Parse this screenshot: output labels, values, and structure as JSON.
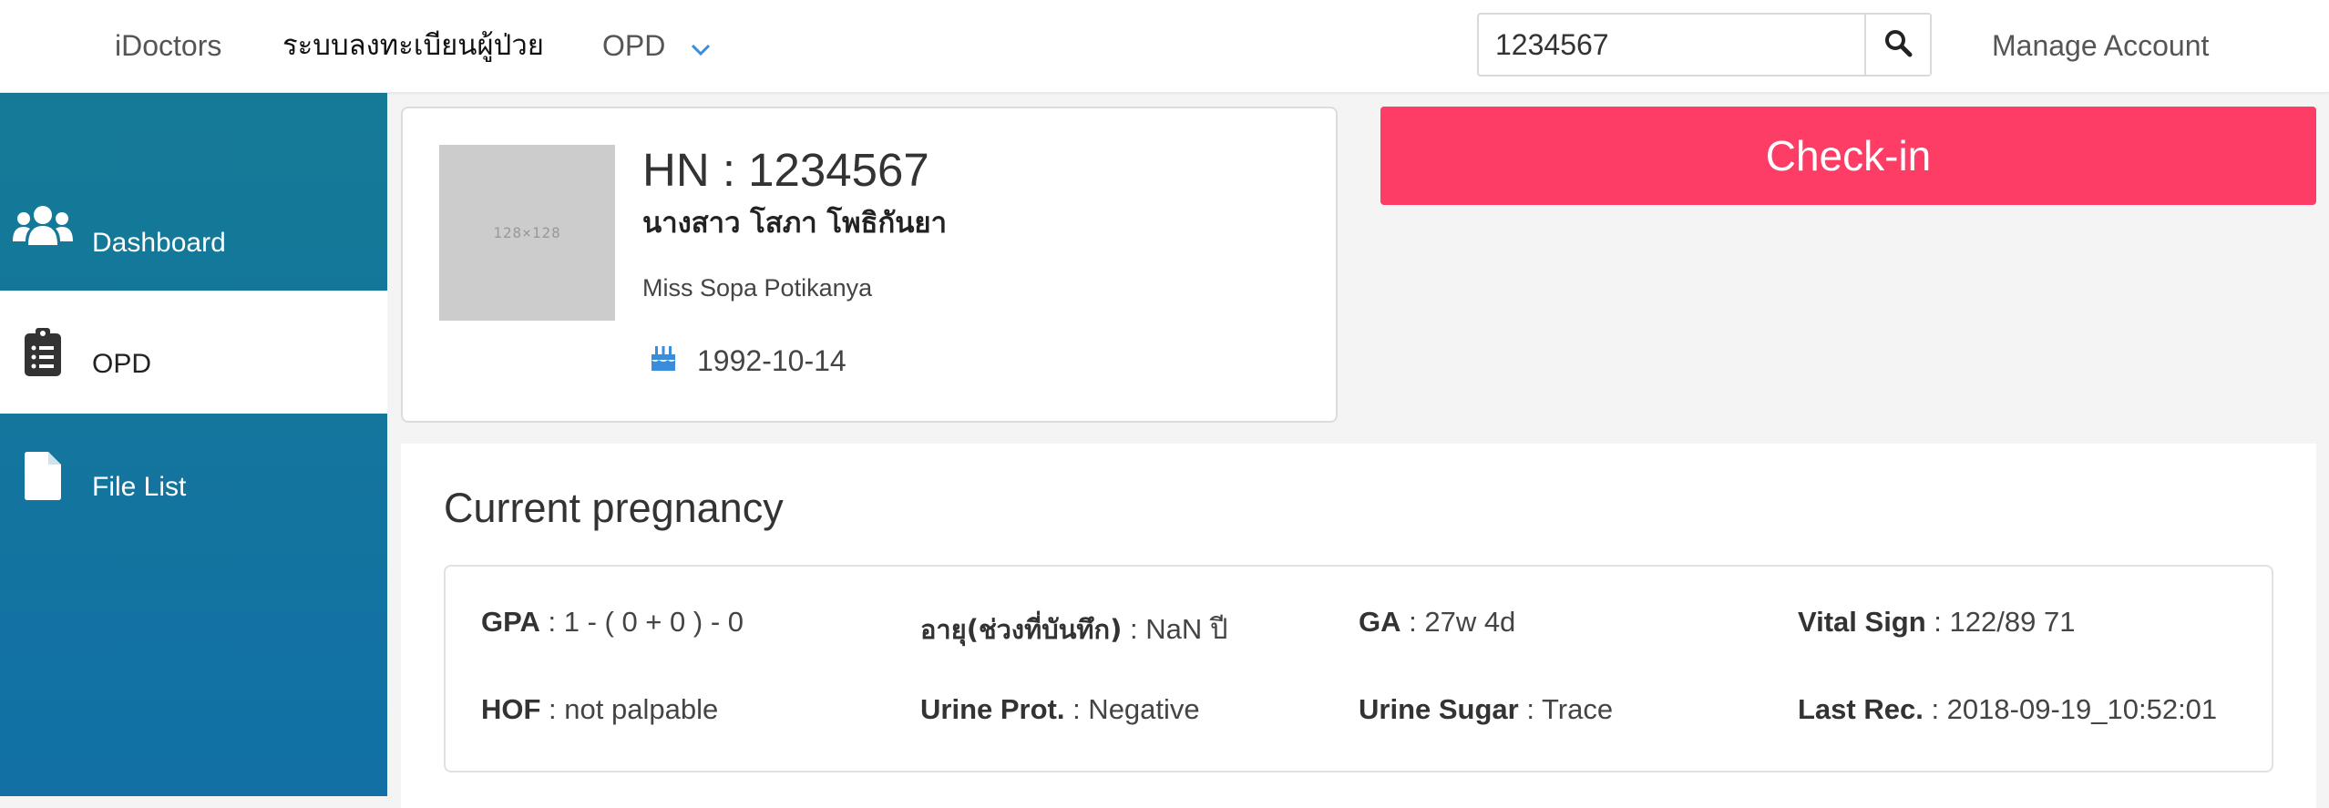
{
  "navbar": {
    "brand": "iDoctors",
    "register_label": "ระบบลงทะเบียนผู้ป่วย",
    "opd_label": "OPD",
    "search_value": "1234567",
    "manage_account": "Manage Account"
  },
  "sidebar": {
    "items": [
      {
        "label": "Dashboard",
        "icon": "users-icon"
      },
      {
        "label": "OPD",
        "icon": "clipboard-icon"
      },
      {
        "label": "File List",
        "icon": "file-icon"
      }
    ]
  },
  "patient": {
    "photo_placeholder": "128×128",
    "hn": "HN : 1234567",
    "name_th": "นางสาว โสภา โพธิกันยา",
    "name_en": "Miss Sopa Potikanya",
    "dob": "1992-10-14"
  },
  "checkin_label": "Check-in",
  "pregnancy": {
    "title": "Current pregnancy",
    "fields": [
      {
        "key": "GPA",
        "value": " : 1 - ( 0 + 0 ) - 0"
      },
      {
        "key": "อายุ(ช่วงที่บันทึก)",
        "value": " : NaN ปี"
      },
      {
        "key": "GA",
        "value": " : 27w 4d"
      },
      {
        "key": "Vital Sign",
        "value": " : 122/89 71"
      },
      {
        "key": "HOF",
        "value": " : not palpable"
      },
      {
        "key": "Urine Prot.",
        "value": " : Negative"
      },
      {
        "key": "Urine Sugar",
        "value": " : Trace"
      },
      {
        "key": "Last Rec.",
        "value": " : 2018-09-19_10:52:01"
      }
    ]
  },
  "colors": {
    "sidebar": "#157a96",
    "checkin": "#fd3d66",
    "accent_icon": "#3a8ddc"
  }
}
